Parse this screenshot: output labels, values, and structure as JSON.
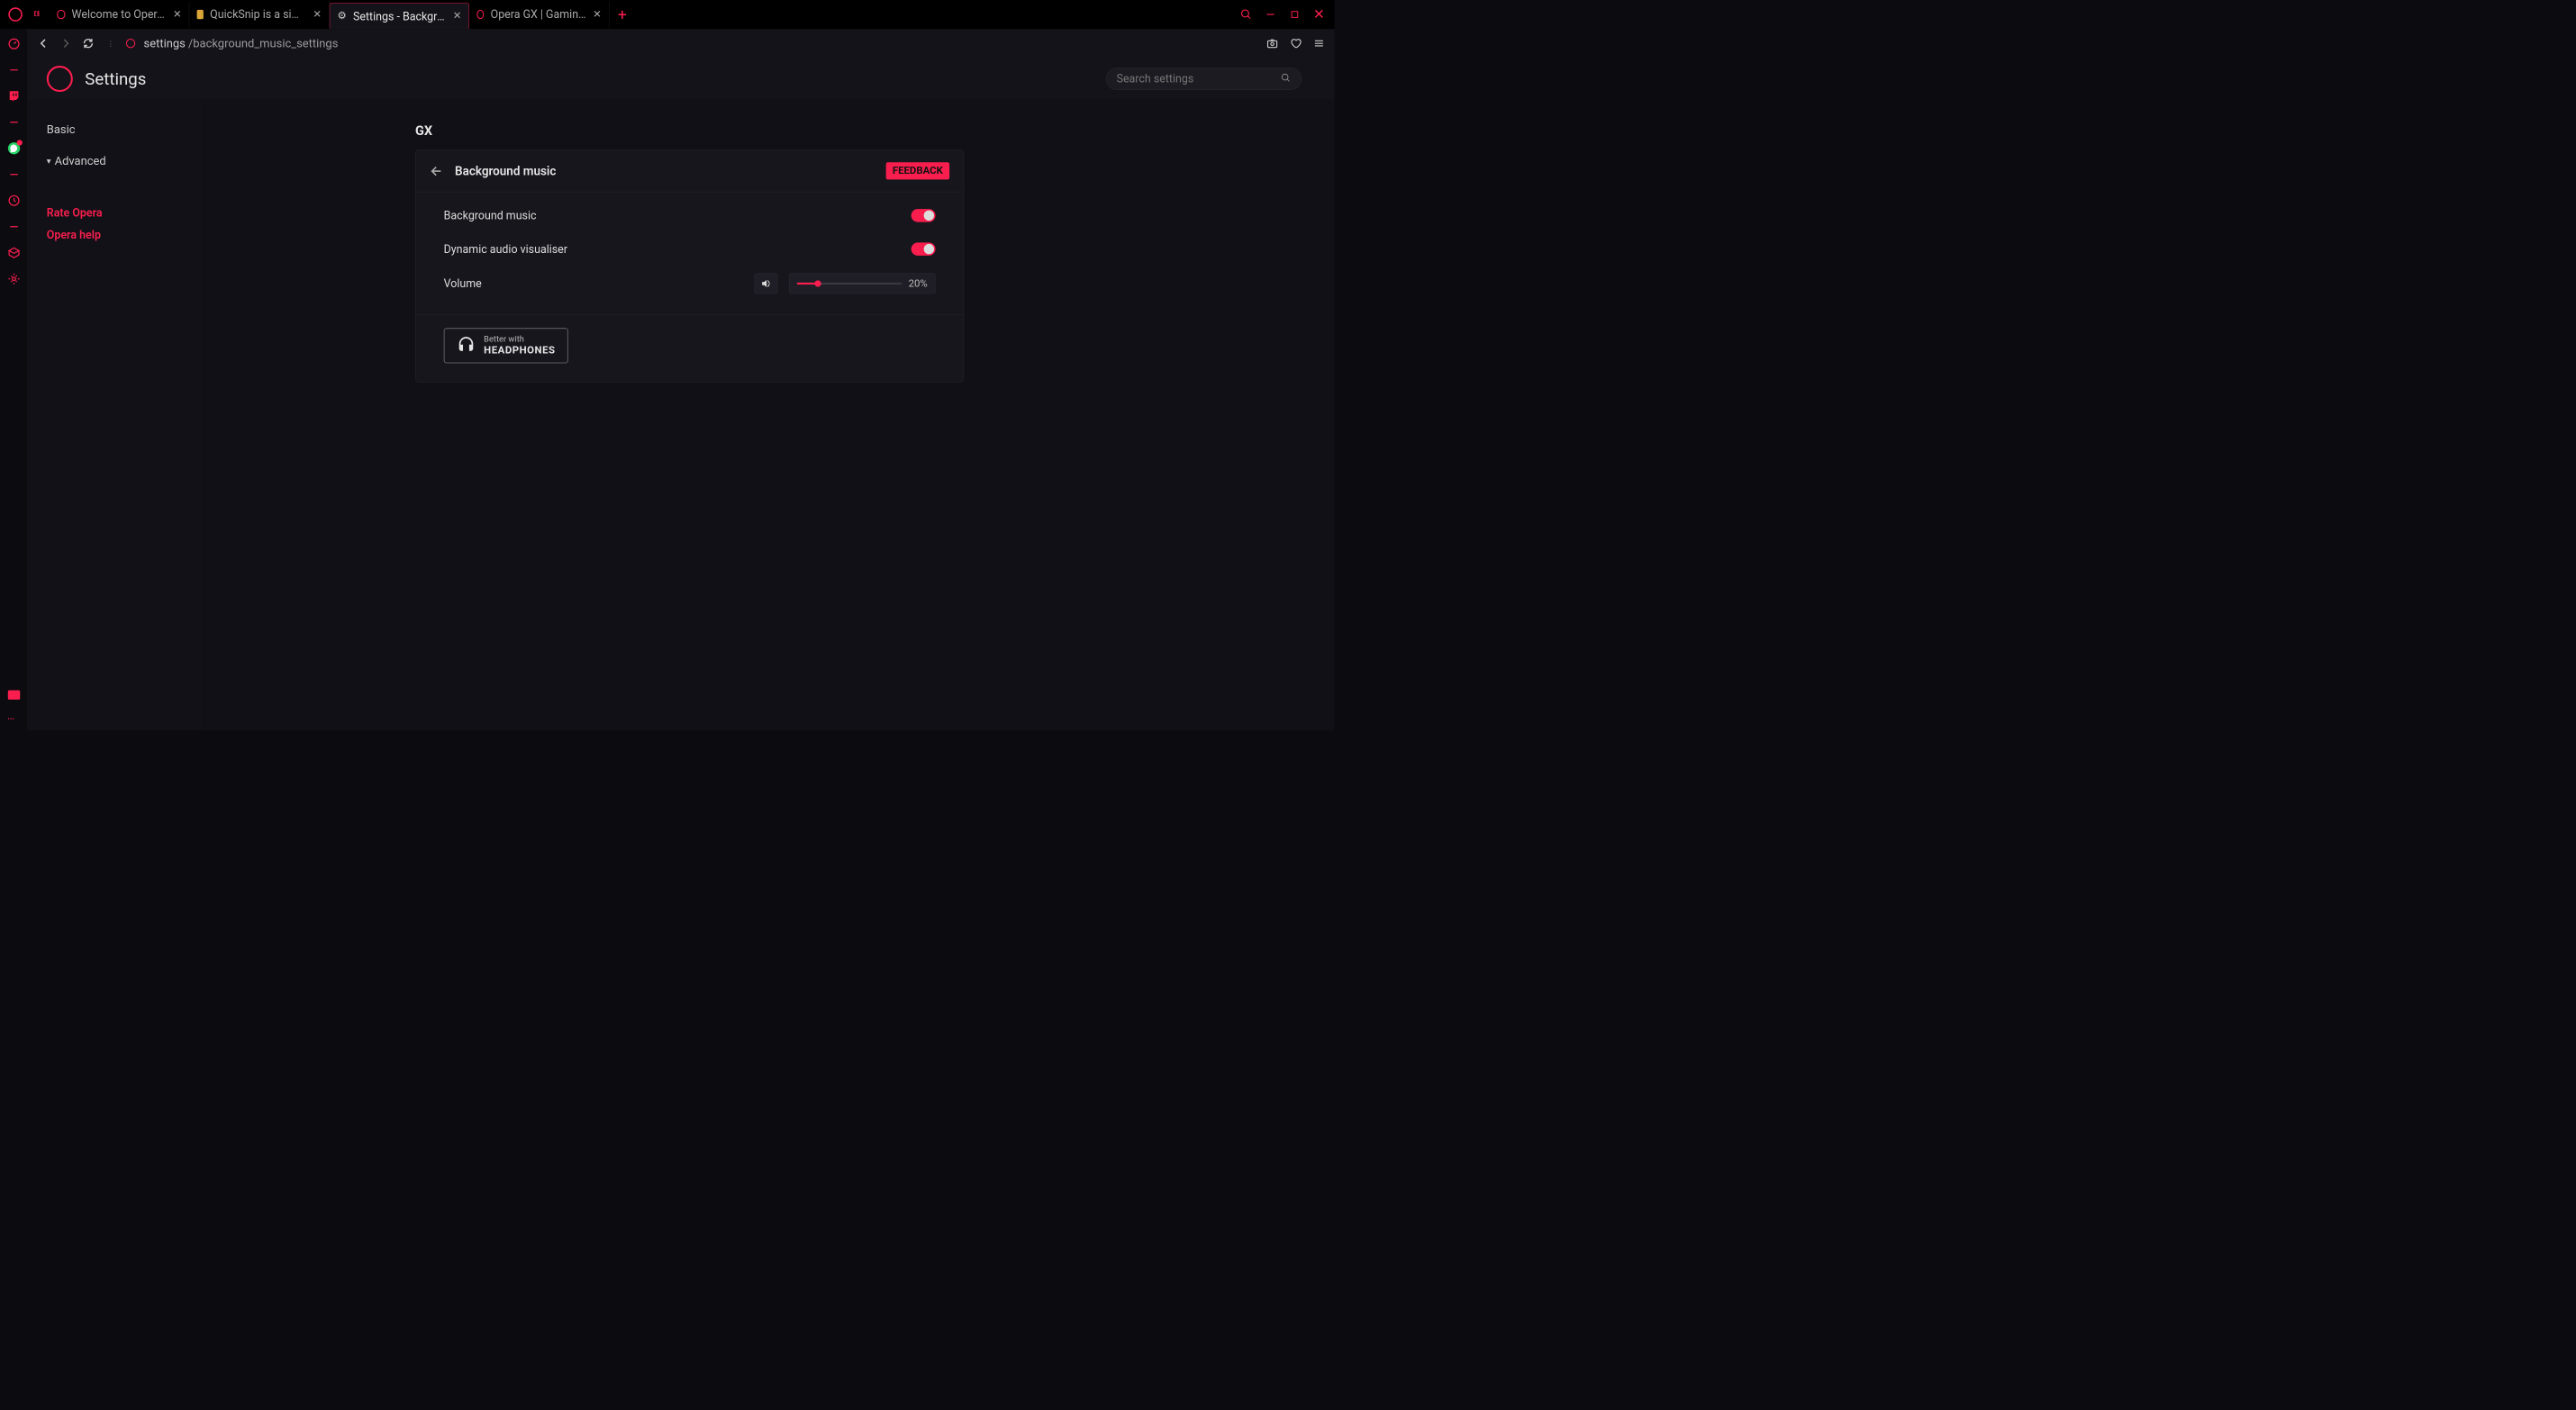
{
  "window": {
    "tabs": [
      {
        "title": "Welcome to Opera GX!",
        "active": false
      },
      {
        "title": "QuickSnip is a simple scree",
        "active": false
      },
      {
        "title": "Settings - Background mus",
        "active": true
      },
      {
        "title": "Opera GX | Gaming Browse",
        "active": false
      }
    ],
    "search_tooltip": "Search"
  },
  "address": {
    "host": "settings",
    "path": "/background_music_settings"
  },
  "page": {
    "title": "Settings",
    "search_placeholder": "Search settings"
  },
  "sidebar": {
    "basic": "Basic",
    "advanced": "Advanced",
    "links": [
      {
        "label": "Rate Opera"
      },
      {
        "label": "Opera help"
      }
    ]
  },
  "content": {
    "section": "GX",
    "card": {
      "title": "Background music",
      "feedback": "FEEDBACK",
      "rows": [
        {
          "label": "Background music",
          "on": true
        },
        {
          "label": "Dynamic audio visualiser",
          "on": true
        }
      ],
      "volume": {
        "label": "Volume",
        "percent": 20,
        "display": "20%"
      },
      "headphones": {
        "small": "Better with",
        "big": "HEADPHONES"
      }
    }
  },
  "colors": {
    "accent": "#fa1e4e"
  }
}
